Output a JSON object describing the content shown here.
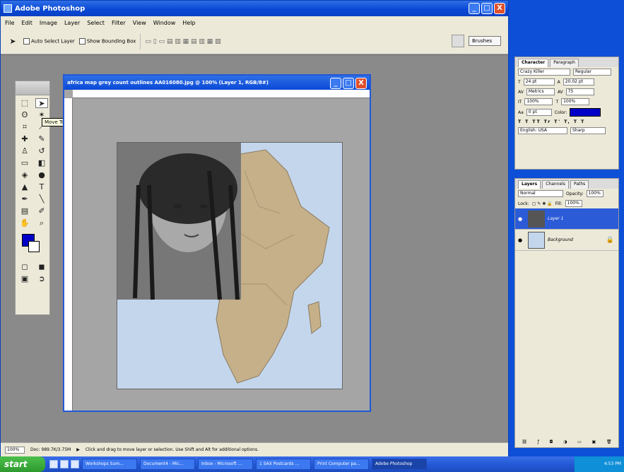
{
  "window": {
    "title": "Adobe Photoshop",
    "controls": [
      "_",
      "□",
      "X"
    ]
  },
  "menu": [
    "File",
    "Edit",
    "Image",
    "Layer",
    "Select",
    "Filter",
    "View",
    "Window",
    "Help"
  ],
  "options_bar": {
    "auto_select_label": "Auto Select Layer",
    "bounding_box_label": "Show Bounding Box",
    "brushes_tab": "Brushes"
  },
  "toolbox": {
    "tooltip": "Move Tool (V)",
    "foreground_color": "#0000c8",
    "background_color": "#ffffff"
  },
  "document": {
    "title": "africa map grey count outlines AA016080.jpg @ 100% (Layer 1, RGB/8#)",
    "controls": [
      "_",
      "□",
      "X"
    ]
  },
  "character_panel": {
    "tabs": [
      "Character",
      "Paragraph"
    ],
    "font_family": "Crazy Killer",
    "font_style": "Regular",
    "font_size": "24 pt",
    "leading": "20.02 pt",
    "kerning": "Metrics",
    "tracking": "75",
    "vertical_scale": "100%",
    "horizontal_scale": "100%",
    "baseline": "0 pt",
    "color_label": "Color:",
    "color": "#0000c8",
    "language": "English: USA",
    "antialias": "Sharp"
  },
  "layers_panel": {
    "tabs": [
      "Layers",
      "Channels",
      "Paths"
    ],
    "blend_mode": "Normal",
    "opacity_label": "Opacity:",
    "opacity": "100%",
    "lock_label": "Lock:",
    "fill_label": "Fill:",
    "fill": "100%",
    "layers": [
      {
        "name": "Layer 1",
        "active": true
      },
      {
        "name": "Background",
        "active": false
      }
    ]
  },
  "status_bar": {
    "zoom": "100%",
    "doc_size": "Doc: 989.7K/3.75M",
    "hint": "Click and drag to move layer or selection. Use Shift and Alt for additional options."
  },
  "taskbar": {
    "start_label": "start",
    "tasks": [
      "Workshops Sum...",
      "Document4 - Mic...",
      "Inbox - Microsoft ...",
      "1 SAX Postcards ...",
      "Print Computer pa...",
      "Adobe Photoshop"
    ],
    "clock": "4:53 PM"
  }
}
